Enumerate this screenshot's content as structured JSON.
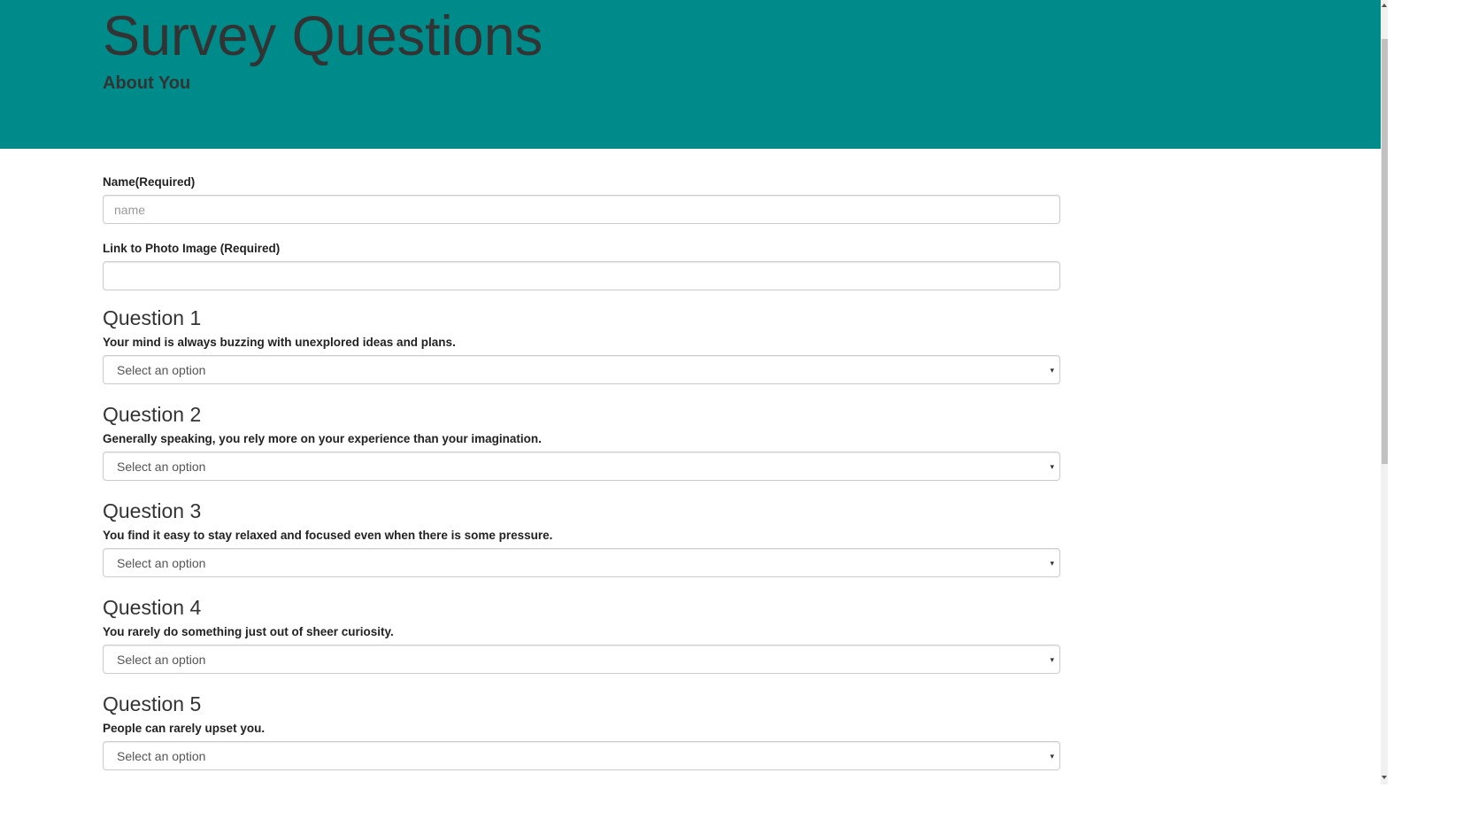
{
  "header": {
    "title": "Survey Questions",
    "subtitle": "About You",
    "background_color": "#008b8b"
  },
  "form": {
    "name_label": "Name(Required)",
    "name_placeholder": "name",
    "name_value": "",
    "photo_label": "Link to Photo Image (Required)",
    "photo_value": ""
  },
  "questions": [
    {
      "title": "Question 1",
      "text": "Your mind is always buzzing with unexplored ideas and plans.",
      "selected": "Select an option"
    },
    {
      "title": "Question 2",
      "text": "Generally speaking, you rely more on your experience than your imagination.",
      "selected": "Select an option"
    },
    {
      "title": "Question 3",
      "text": "You find it easy to stay relaxed and focused even when there is some pressure.",
      "selected": "Select an option"
    },
    {
      "title": "Question 4",
      "text": "You rarely do something just out of sheer curiosity.",
      "selected": "Select an option"
    },
    {
      "title": "Question 5",
      "text": "People can rarely upset you.",
      "selected": "Select an option"
    }
  ],
  "icons": {
    "dropdown_arrow": "chevron-down-icon",
    "dropdown_arrow_glyph": "▾"
  }
}
